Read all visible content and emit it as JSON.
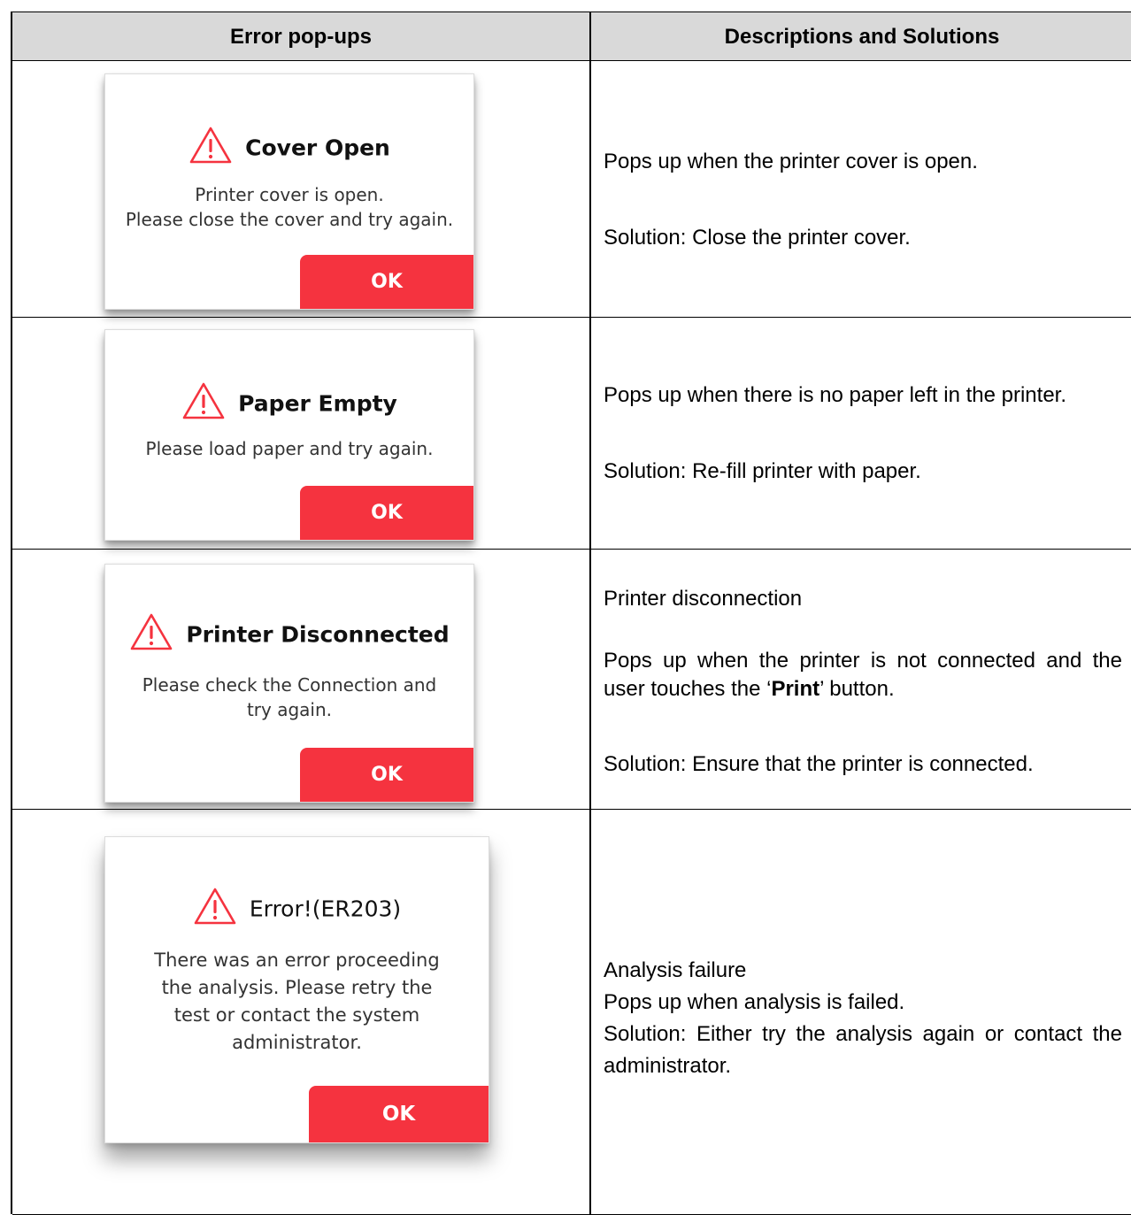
{
  "header": {
    "col1": "Error pop-ups",
    "col2": "Descriptions and Solutions"
  },
  "rows": [
    {
      "popup": {
        "icon": "warning-triangle-icon",
        "title": "Cover Open",
        "message_lines": [
          "Printer cover is open.",
          "Please close the cover and try again."
        ],
        "ok_label": "OK"
      },
      "description": "Pops up when the printer cover is open.",
      "solution": "Solution: Close the printer cover."
    },
    {
      "popup": {
        "icon": "warning-triangle-icon",
        "title": "Paper Empty",
        "message_lines": [
          "Please load paper and try again."
        ],
        "ok_label": "OK"
      },
      "description": "Pops up when there is no paper left in the printer.",
      "solution": "Solution: Re-fill printer with paper."
    },
    {
      "popup": {
        "icon": "warning-triangle-icon",
        "title": "Printer Disconnected",
        "message_lines": [
          "Please check the Connection and",
          "try again."
        ],
        "ok_label": "OK"
      },
      "heading": "Printer disconnection",
      "description_pre": "Pops up when the printer is not connected and the user touches the ‘",
      "description_bold": "Print",
      "description_post": "’ button.",
      "solution": "Solution: Ensure that the printer is connected."
    },
    {
      "popup": {
        "icon": "warning-triangle-icon",
        "title": "Error!(ER203)",
        "message_lines": [
          "There was an error proceeding",
          "the analysis. Please retry the",
          "test or contact the system",
          "administrator."
        ],
        "ok_label": "OK"
      },
      "heading": "Analysis failure",
      "description": "Pops up when analysis is failed.",
      "solution": "Solution: Either try the analysis again or contact the administrator."
    }
  ],
  "colors": {
    "accent": "#f5333f",
    "header_bg": "#d9d9d9"
  }
}
